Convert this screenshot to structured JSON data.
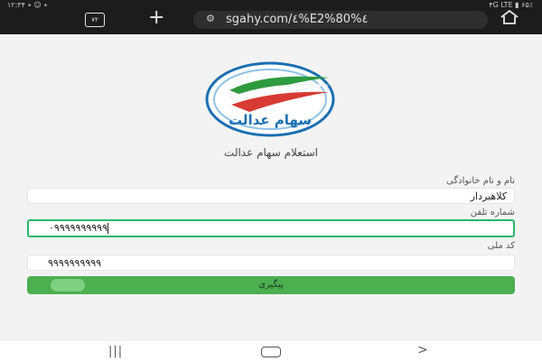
{
  "status": {
    "left": "۱۲:۳۴ ٭ ☺ ٭",
    "right": "۴G  LTE  ▮ ۶۵٪"
  },
  "browser": {
    "tab_count": "۷۲",
    "url": "sgahy.com/٤%E2%80%٤"
  },
  "logo": {
    "text": "سهام عدالت"
  },
  "page": {
    "title": "استعلام سهام عدالت"
  },
  "form": {
    "name_label": "نام و نام خانوادگی",
    "name_value": "کلاهبردار",
    "phone_label": "شماره تلفن",
    "phone_value": "۰۹۹۹۹۹۹۹۹۹۹",
    "national_label": "کد ملی",
    "national_value": "۹۹۹۹۹۹۹۹۹۹",
    "submit_label": "پیگیری"
  },
  "colors": {
    "accent": "#4caf50",
    "focus_border": "#29b86a",
    "topbar": "#1c1c1c"
  },
  "icons": {
    "tabs": "tabs-icon",
    "new_tab": "plus-icon",
    "site_settings": "tune-icon",
    "home": "home-icon",
    "nav_recent": "recent-apps-icon",
    "nav_home": "home-pill-icon",
    "nav_back": "back-icon"
  }
}
